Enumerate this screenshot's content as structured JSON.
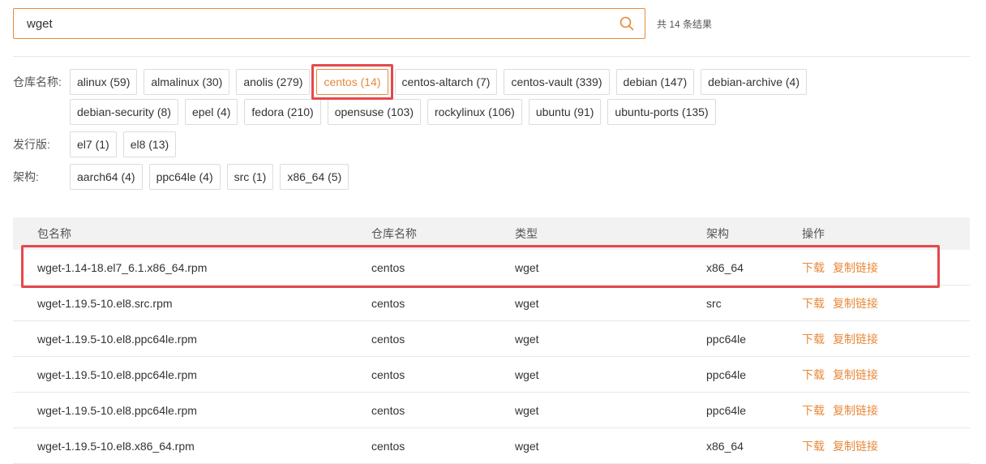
{
  "search": {
    "value": "wget",
    "result_count": "共 14 条结果"
  },
  "filters": {
    "repo": {
      "label": "仓库名称:",
      "options": [
        "alinux (59)",
        "almalinux (30)",
        "anolis (279)",
        "centos (14)",
        "centos-altarch (7)",
        "centos-vault (339)",
        "debian (147)",
        "debian-archive (4)",
        "debian-security (8)",
        "epel (4)",
        "fedora (210)",
        "opensuse (103)",
        "rockylinux (106)",
        "ubuntu (91)",
        "ubuntu-ports (135)"
      ],
      "selected": "centos (14)"
    },
    "release": {
      "label": "发行版:",
      "options": [
        "el7 (1)",
        "el8 (13)"
      ]
    },
    "arch": {
      "label": "架构:",
      "options": [
        "aarch64 (4)",
        "ppc64le (4)",
        "src (1)",
        "x86_64 (5)"
      ]
    }
  },
  "table": {
    "headers": [
      "包名称",
      "仓库名称",
      "类型",
      "架构",
      "操作"
    ],
    "download_label": "下载",
    "copy_label": "复制链接",
    "rows": [
      {
        "name": "wget-1.14-18.el7_6.1.x86_64.rpm",
        "repo": "centos",
        "type": "wget",
        "arch": "x86_64"
      },
      {
        "name": "wget-1.19.5-10.el8.src.rpm",
        "repo": "centos",
        "type": "wget",
        "arch": "src"
      },
      {
        "name": "wget-1.19.5-10.el8.ppc64le.rpm",
        "repo": "centos",
        "type": "wget",
        "arch": "ppc64le"
      },
      {
        "name": "wget-1.19.5-10.el8.ppc64le.rpm",
        "repo": "centos",
        "type": "wget",
        "arch": "ppc64le"
      },
      {
        "name": "wget-1.19.5-10.el8.ppc64le.rpm",
        "repo": "centos",
        "type": "wget",
        "arch": "ppc64le"
      },
      {
        "name": "wget-1.19.5-10.el8.x86_64.rpm",
        "repo": "centos",
        "type": "wget",
        "arch": "x86_64"
      }
    ]
  },
  "colors": {
    "accent": "#e8893a",
    "highlight": "#e5484d"
  }
}
